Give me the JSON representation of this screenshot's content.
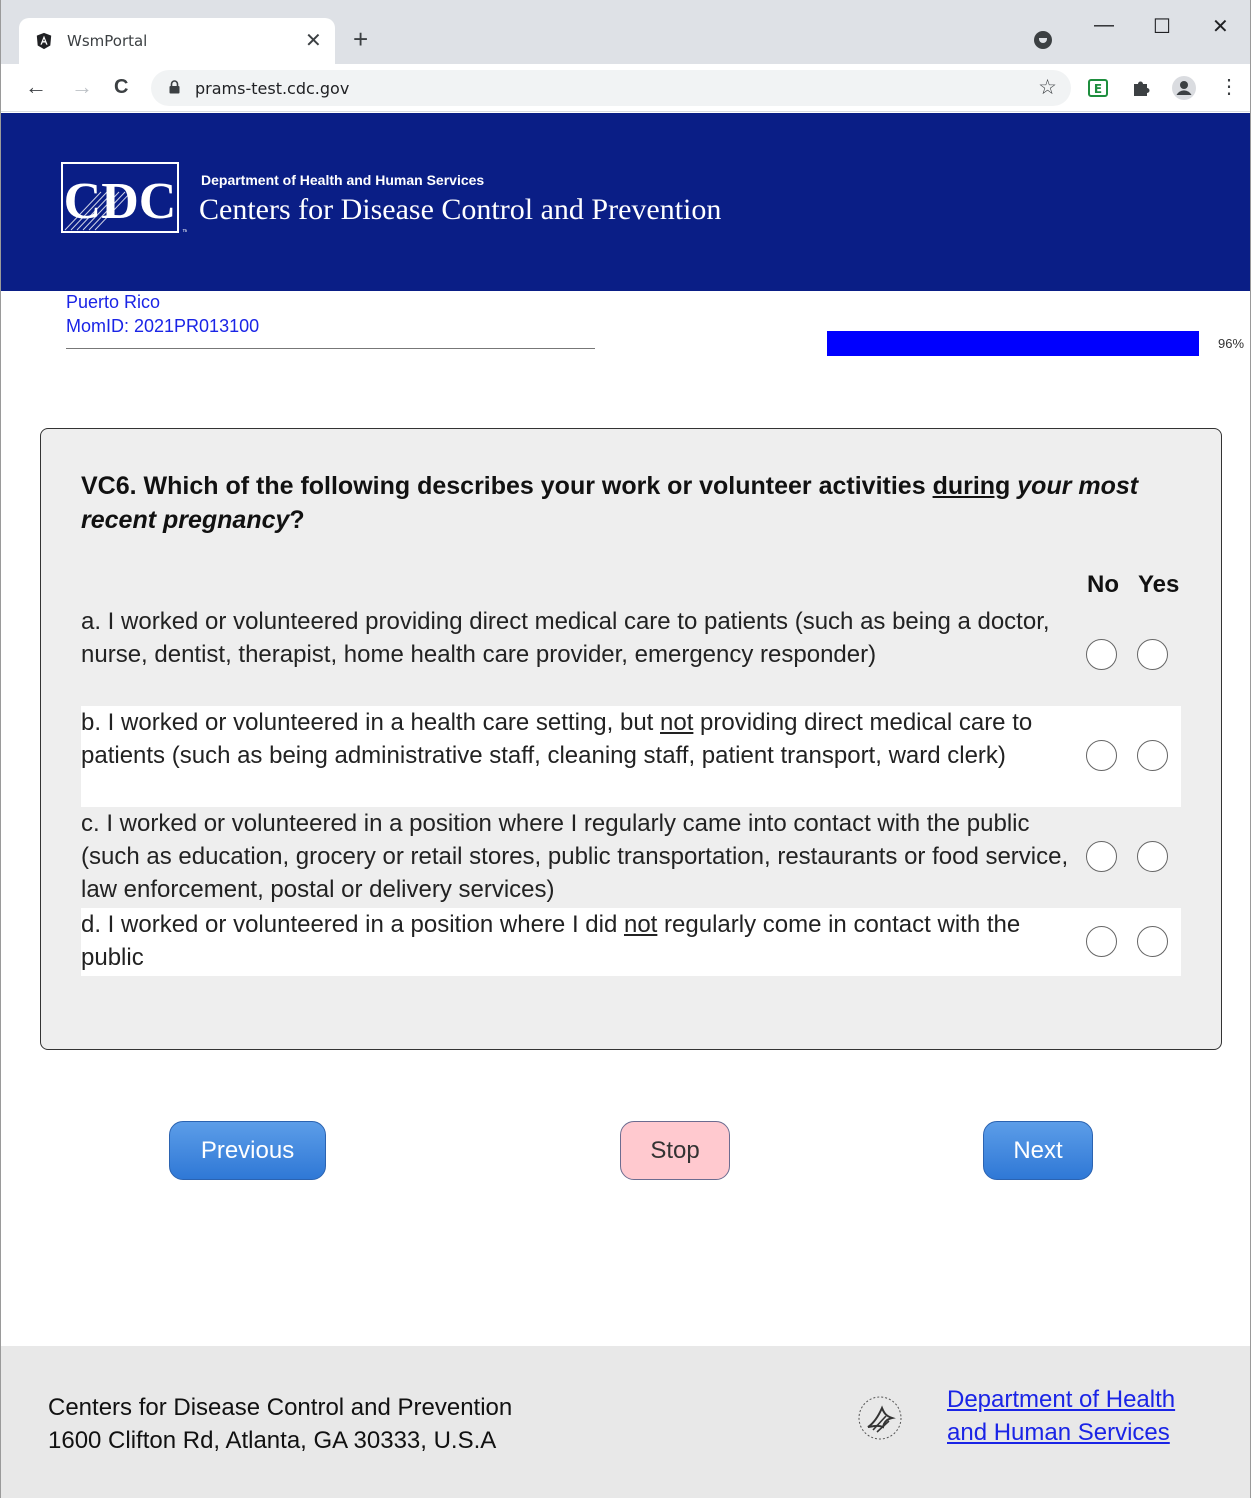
{
  "browser": {
    "tab_title": "WsmPortal",
    "tab_close": "✕",
    "new_tab": "+",
    "url": "prams-test.cdc.gov",
    "minimize": "—",
    "maximize": "☐",
    "close": "✕",
    "back": "←",
    "forward": "→",
    "reload": "C",
    "bookmark": "☆",
    "menu": "⋮"
  },
  "header": {
    "logo_text": "CDC",
    "dept_small": "Department of Health and Human Services",
    "dept_big": "Centers for Disease Control and Prevention"
  },
  "respondent": {
    "state": "Puerto Rico",
    "mom_id": "MomID: 2021PR013100"
  },
  "progress": {
    "percent": 96,
    "label": "96%"
  },
  "question": {
    "lead": "VC6. Which of the following describes your work or volunteer activities",
    "underlined": "during",
    "italic": "your most recent pregnancy",
    "end": "?",
    "col_no": "No",
    "col_yes": "Yes",
    "items": [
      {
        "parts": [
          "a. I worked or volunteered providing direct medical care to patients (such as being a doctor, nurse, dentist, therapist, home health care provider, emergency responder)"
        ]
      },
      {
        "parts": [
          "b. I worked or volunteered in a health care setting, but ",
          "not",
          " providing direct medical care to patients (such as being administrative staff, cleaning staff, patient transport, ward clerk)"
        ]
      },
      {
        "parts": [
          "c. I worked or volunteered in a position where I regularly came into contact with the public (such as education, grocery or retail stores, public transportation, restaurants or food service, law enforcement, postal or delivery services)"
        ]
      },
      {
        "parts": [
          "d. I worked or volunteered in a position where I did ",
          "not",
          " regularly come in contact with the public"
        ]
      }
    ]
  },
  "nav": {
    "previous": "Previous",
    "stop": "Stop",
    "next": "Next"
  },
  "footer": {
    "org": "Centers for Disease Control and Prevention",
    "address": "1600 Clifton Rd, Atlanta, GA 30333, U.S.A",
    "link_line1": "Department of Health",
    "link_line2": "and Human Services"
  },
  "colors": {
    "banner": "#0a1e86",
    "progress": "#0000ff",
    "link": "#1a24e6",
    "button_blue": "#2f78d6",
    "button_stop": "#ffc9cf"
  },
  "icons": [
    "angular-favicon-icon",
    "lock-icon",
    "star-icon",
    "excel-extension-icon",
    "puzzle-icon",
    "profile-icon",
    "menu-dots-icon",
    "hhs-eagle-icon"
  ]
}
